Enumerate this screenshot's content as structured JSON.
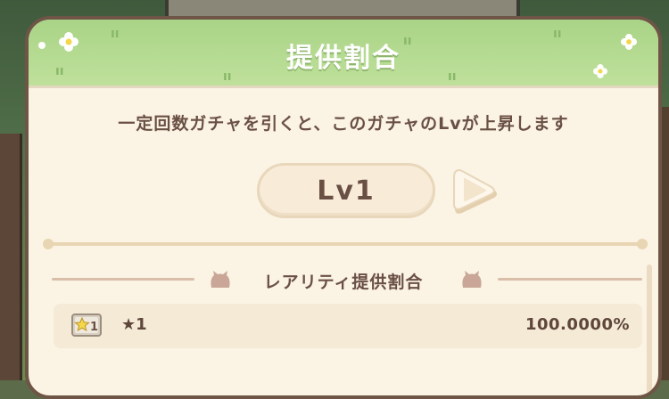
{
  "modal": {
    "title": "提供割合",
    "description": "一定回数ガチャを引くと、このガチャのLvが上昇します"
  },
  "level": {
    "label": "Lv1"
  },
  "section": {
    "title": "レアリティ提供割合"
  },
  "rarities": [
    {
      "icon": "star-rarity-badge-icon",
      "badge_text": "1",
      "name": "★1",
      "rate": "100.0000%"
    }
  ],
  "colors": {
    "header_green": "#a9d486",
    "panel_cream": "#fbf3e4",
    "border_brown": "#6e5546",
    "text_brown": "#6a5044",
    "accent_line": "#e8d5b3"
  }
}
